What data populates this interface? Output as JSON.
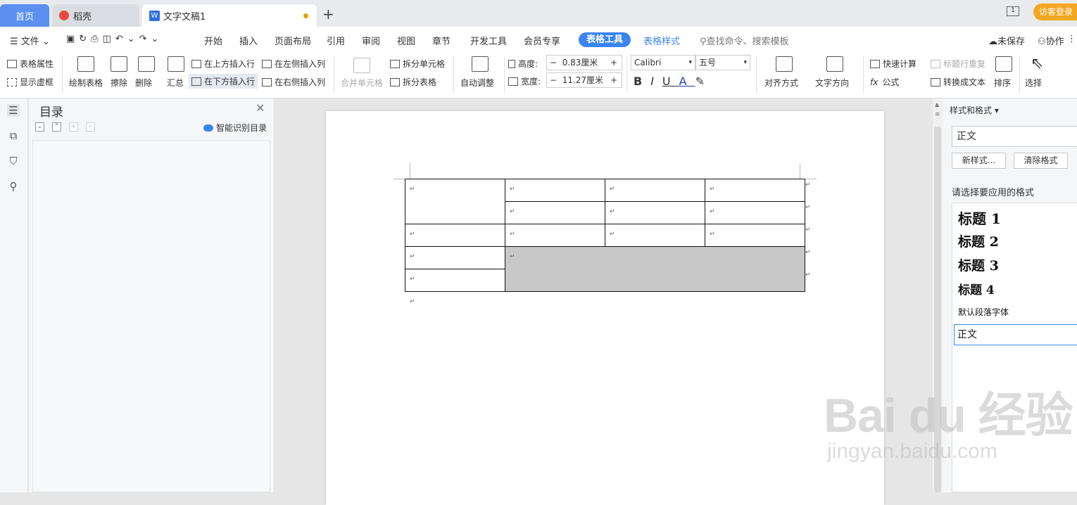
{
  "tabs": {
    "home": "首页",
    "daoke": "稻壳",
    "doc": "文字文稿1",
    "new_tab": "+"
  },
  "login": "访客登录",
  "menu": {
    "file": "文件",
    "items": [
      "开始",
      "插入",
      "页面布局",
      "引用",
      "审阅",
      "视图",
      "章节",
      "开发工具",
      "会员专享"
    ],
    "active": "表格工具",
    "table_style": "表格样式",
    "search": "查找命令、搜索模板",
    "unsaved": "未保存",
    "collab": "协作"
  },
  "ribbon": {
    "table_props": "表格属性",
    "show_grid": "显示虚框",
    "draw_table": "绘制表格",
    "erase": "擦除",
    "delete": "删除",
    "summary": "汇总",
    "insert_above": "在上方插入行",
    "insert_below": "在下方插入行",
    "insert_left": "在左侧插入列",
    "insert_right": "在右侧插入列",
    "merge": "合并单元格",
    "split_cell": "拆分单元格",
    "split_table": "拆分表格",
    "auto_fit": "自动调整",
    "height_label": "高度:",
    "height_value": "0.83厘米",
    "width_label": "宽度:",
    "width_value": "11.27厘米",
    "font": "Calibri",
    "size": "五号",
    "align": "对齐方式",
    "text_dir": "文字方向",
    "quick_calc": "快速计算",
    "header_repeat": "标题行重复",
    "formula": "公式",
    "to_text": "转换成文本",
    "sort": "排序",
    "select": "选择"
  },
  "toc": {
    "title": "目录",
    "smart": "智能识别目录"
  },
  "styles": {
    "header": "样式和格式",
    "current": "正文",
    "new_style": "新样式...",
    "clear": "清除格式",
    "prompt": "请选择要应用的格式",
    "list": [
      "标题 1",
      "标题 2",
      "标题 3",
      "标题 4",
      "默认段落字体",
      "正文"
    ]
  },
  "para_mark": "↵",
  "watermark": "Bai du 经验",
  "watermark_url": "jingyan.baidu.com",
  "colors": {
    "accent": "#3a84f0",
    "login": "#f5a623",
    "merged_cell": "#c8c8c8"
  }
}
